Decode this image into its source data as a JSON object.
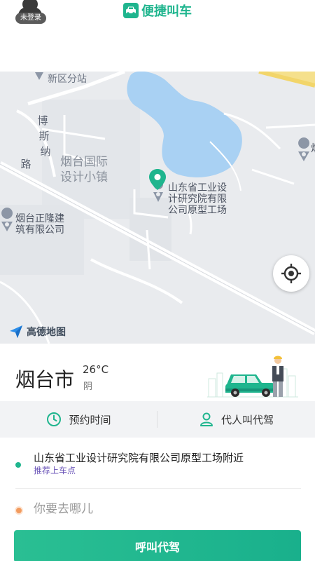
{
  "header": {
    "login_badge": "未登录",
    "app_title": "便捷叫车",
    "app_icon": "car-icon"
  },
  "map": {
    "labels": {
      "top_station": "新区分站",
      "road_name": [
        "博",
        "斯",
        "纳",
        "路"
      ],
      "town_line1": "烟台国际",
      "town_line2": "设计小镇",
      "poi_line1": "山东省工业设",
      "poi_line2": "计研究院有限",
      "poi_line3": "公司原型工场",
      "company_line1": "烟台正隆建",
      "company_line2": "筑有限公司",
      "edge_label": "烟"
    },
    "provider_logo": "高德地图",
    "water_color": "#a9d1f3",
    "pin_color": "#1fb58e"
  },
  "weather": {
    "city": "烟台市",
    "temperature": "26°C",
    "condition": "阴"
  },
  "options": {
    "schedule_label": "预约时间",
    "schedule_icon": "clock-icon",
    "proxy_label": "代人叫代驾",
    "proxy_icon": "person-icon"
  },
  "address": {
    "pickup_text": "山东省工业设计研究院有限公司原型工场附近",
    "pickup_hint": "推荐上车点",
    "destination_placeholder": "你要去哪儿"
  },
  "call_button": "呼叫代驾",
  "colors": {
    "accent": "#1fb58e",
    "hint_purple": "#6b55b8",
    "destination_dot": "#f29b5e"
  }
}
